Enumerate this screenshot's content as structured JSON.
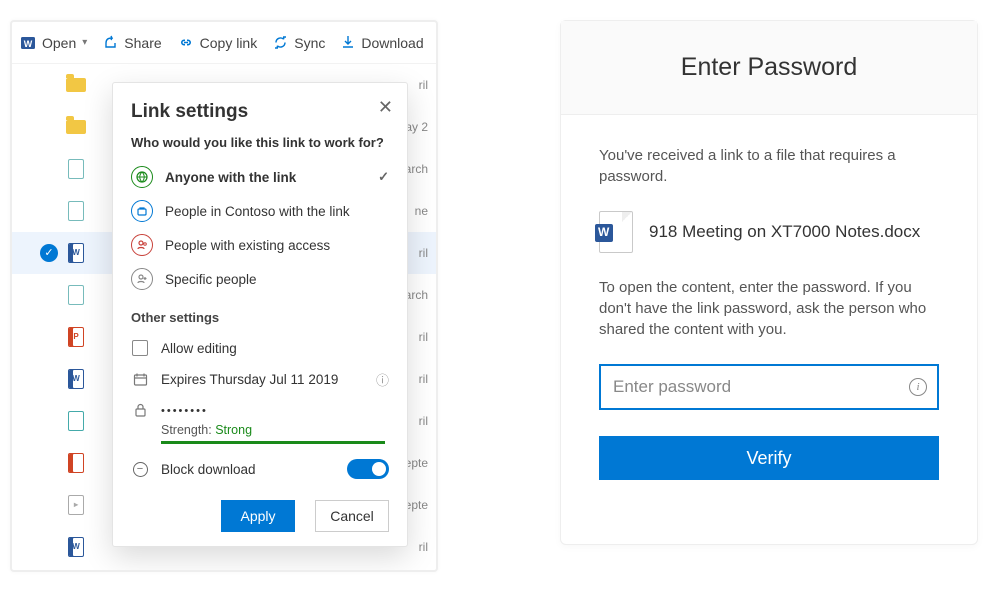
{
  "toolbar": {
    "open": "Open",
    "share": "Share",
    "copylink": "Copy link",
    "sync": "Sync",
    "download": "Download"
  },
  "files": {
    "r0": {
      "meta": ""
    },
    "r1": {
      "meta": "ril"
    },
    "r2": {
      "meta": "ay 2"
    },
    "r3": {
      "meta": "arch"
    },
    "r4": {
      "meta": "ne"
    },
    "r5": {
      "meta": "ril"
    },
    "r6": {
      "meta": "arch"
    },
    "r7": {
      "meta": "ril"
    },
    "r8": {
      "meta": "ril"
    },
    "r9": {
      "meta": "ril"
    },
    "r10": {
      "meta": "epte"
    },
    "r11": {
      "meta": "epte"
    },
    "r12": {
      "meta": "ril"
    }
  },
  "pop": {
    "title": "Link settings",
    "subtitle": "Who would you like this link to work for?",
    "anyone": "Anyone with the link",
    "org": "People in Contoso with the link",
    "existing": "People with existing access",
    "specific": "Specific people",
    "otherHeader": "Other settings",
    "allowEdit": "Allow editing",
    "expires": "Expires Thursday Jul 11 2019",
    "passwordMasked": "••••••••",
    "strengthLabel": "Strength: ",
    "strengthValue": "Strong",
    "blockDownload": "Block download",
    "apply": "Apply",
    "cancel": "Cancel"
  },
  "ep": {
    "title": "Enter Password",
    "msg1": "You've received a link to a file that requires a password.",
    "filename": "918 Meeting on XT7000 Notes.docx",
    "msg2": "To open the content, enter the password. If you don't have the link password, ask the person who shared the content with you.",
    "placeholder": "Enter password",
    "verify": "Verify"
  }
}
